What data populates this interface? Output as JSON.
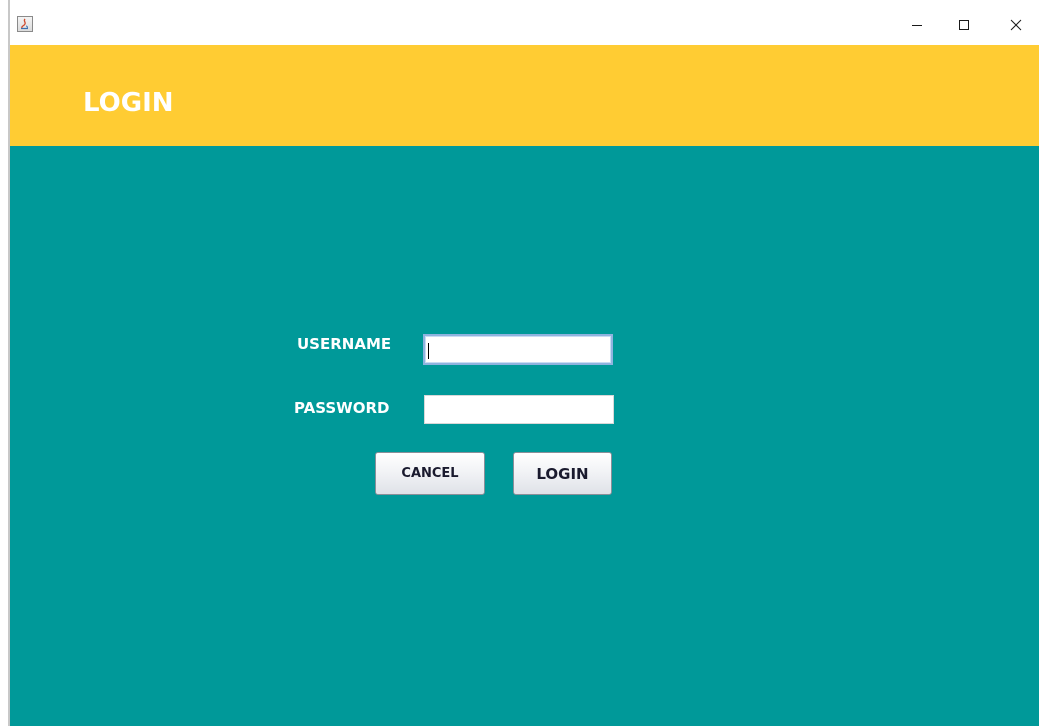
{
  "window": {
    "controls": {
      "minimize_glyph": "–",
      "maximize_glyph": "☐",
      "close_glyph": "✕"
    },
    "icons": [
      "java-app-icon",
      "minimize-icon",
      "maximize-icon",
      "close-icon"
    ]
  },
  "header": {
    "title": "LOGIN"
  },
  "form": {
    "username_label": "USERNAME",
    "username_value": "",
    "password_label": "PASSWORD",
    "password_value": ""
  },
  "buttons": {
    "cancel_label": "CANCEL",
    "login_label": "LOGIN"
  },
  "colors": {
    "header_bg": "#ffcc33",
    "content_bg": "#009999",
    "label_text": "#ffffff"
  }
}
